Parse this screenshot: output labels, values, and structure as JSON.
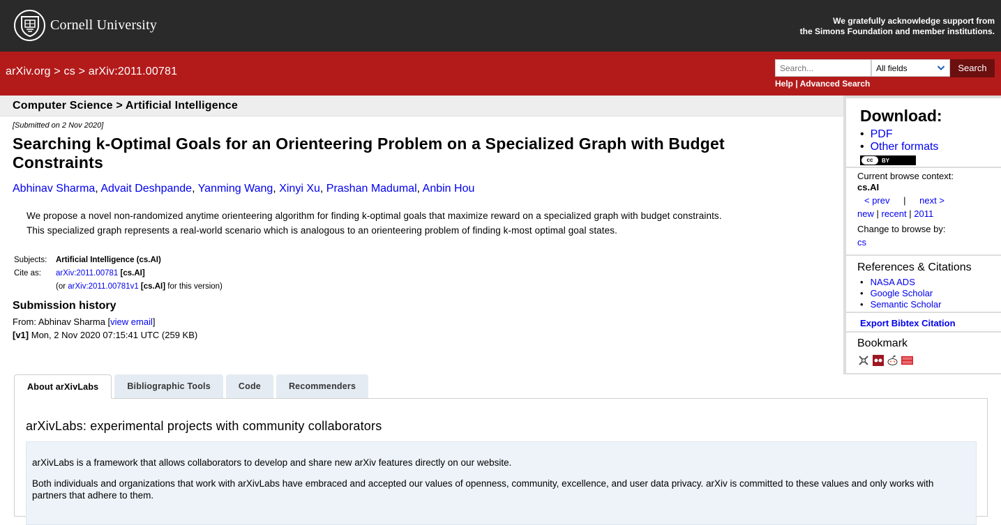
{
  "topbar": {
    "university": "Cornell University",
    "support_line1": "We gratefully acknowledge support from",
    "support_line2": "the Simons Foundation and member institutions."
  },
  "header": {
    "crumb_site": "arXiv.org",
    "crumb_sep": ">",
    "crumb_cat": "cs",
    "crumb_id": "arXiv:2011.00781",
    "search_placeholder": "Search...",
    "search_field": "All fields",
    "search_button": "Search",
    "help": "Help",
    "link_sep": "|",
    "advanced": "Advanced Search",
    "brand_color": "#b31b1b"
  },
  "subheader": {
    "label": "Computer Science > Artificial Intelligence"
  },
  "paper": {
    "submitted": "[Submitted on 2 Nov 2020]",
    "title": "Searching k-Optimal Goals for an Orienteering Problem on a Specialized Graph with Budget Constraints",
    "authors": [
      "Abhinav Sharma",
      "Advait Deshpande",
      "Yanming Wang",
      "Xinyi Xu",
      "Prashan Madumal",
      "Anbin Hou"
    ],
    "author_sep": ",",
    "abstract_line1": "We propose a novel non-randomized anytime orienteering algorithm for finding k-optimal goals that maximize reward on a specialized graph with budget constraints.",
    "abstract_line2": "This specialized graph represents a real-world scenario which is analogous to an orienteering problem of finding k-most optimal goal states.",
    "subjects_label": "Subjects:",
    "subjects_value": "Artificial Intelligence (cs.AI)",
    "cite_label": "Cite as:",
    "cite_id": "arXiv:2011.00781",
    "cite_cat": "[cs.AI]",
    "cite_version_prefix": "(or",
    "cite_version_id": "arXiv:2011.00781v1",
    "cite_version_cat": "[cs.AI]",
    "cite_version_suffix": "for this version)"
  },
  "history": {
    "title": "Submission history",
    "from_prefix": "From: Abhinav Sharma [",
    "view_email": "view email",
    "from_suffix": "]",
    "v1_label": "[v1]",
    "v1_text": "Mon, 2 Nov 2020 07:15:41 UTC (259 KB)"
  },
  "sidebar": {
    "download_title": "Download:",
    "pdf": "PDF",
    "other_formats": "Other formats",
    "license_icon": "cc-by-icon",
    "cc_left": "cc",
    "cc_right": "BY",
    "browse_context_label": "Current browse context:",
    "browse_context": "cs.AI",
    "prev": "< prev",
    "nav_sep": "|",
    "next": "next >",
    "new": "new",
    "recent": "recent",
    "year": "2011",
    "change_browse": "Change to browse by:",
    "browse_cs": "cs",
    "refs_title": "References & Citations",
    "refs": [
      "NASA ADS",
      "Google Scholar",
      "Semantic Scholar"
    ],
    "bibtex": "Export Bibtex Citation",
    "bookmark_title": "Bookmark",
    "bookmark_icons": [
      "bibsonomy-icon",
      "mendeley-icon",
      "reddit-icon",
      "sciencewise-icon"
    ]
  },
  "tabs": [
    "About arXivLabs",
    "Bibliographic Tools",
    "Code",
    "Recommenders"
  ],
  "labs": {
    "title": "arXivLabs: experimental projects with community collaborators",
    "p1": "arXivLabs is a framework that allows collaborators to develop and share new arXiv features directly on our website.",
    "p2": "Both individuals and organizations that work with arXivLabs have embraced and accepted our values of openness, community, excellence, and user data privacy. arXiv is committed to these values and only works with partners that adhere to them."
  }
}
